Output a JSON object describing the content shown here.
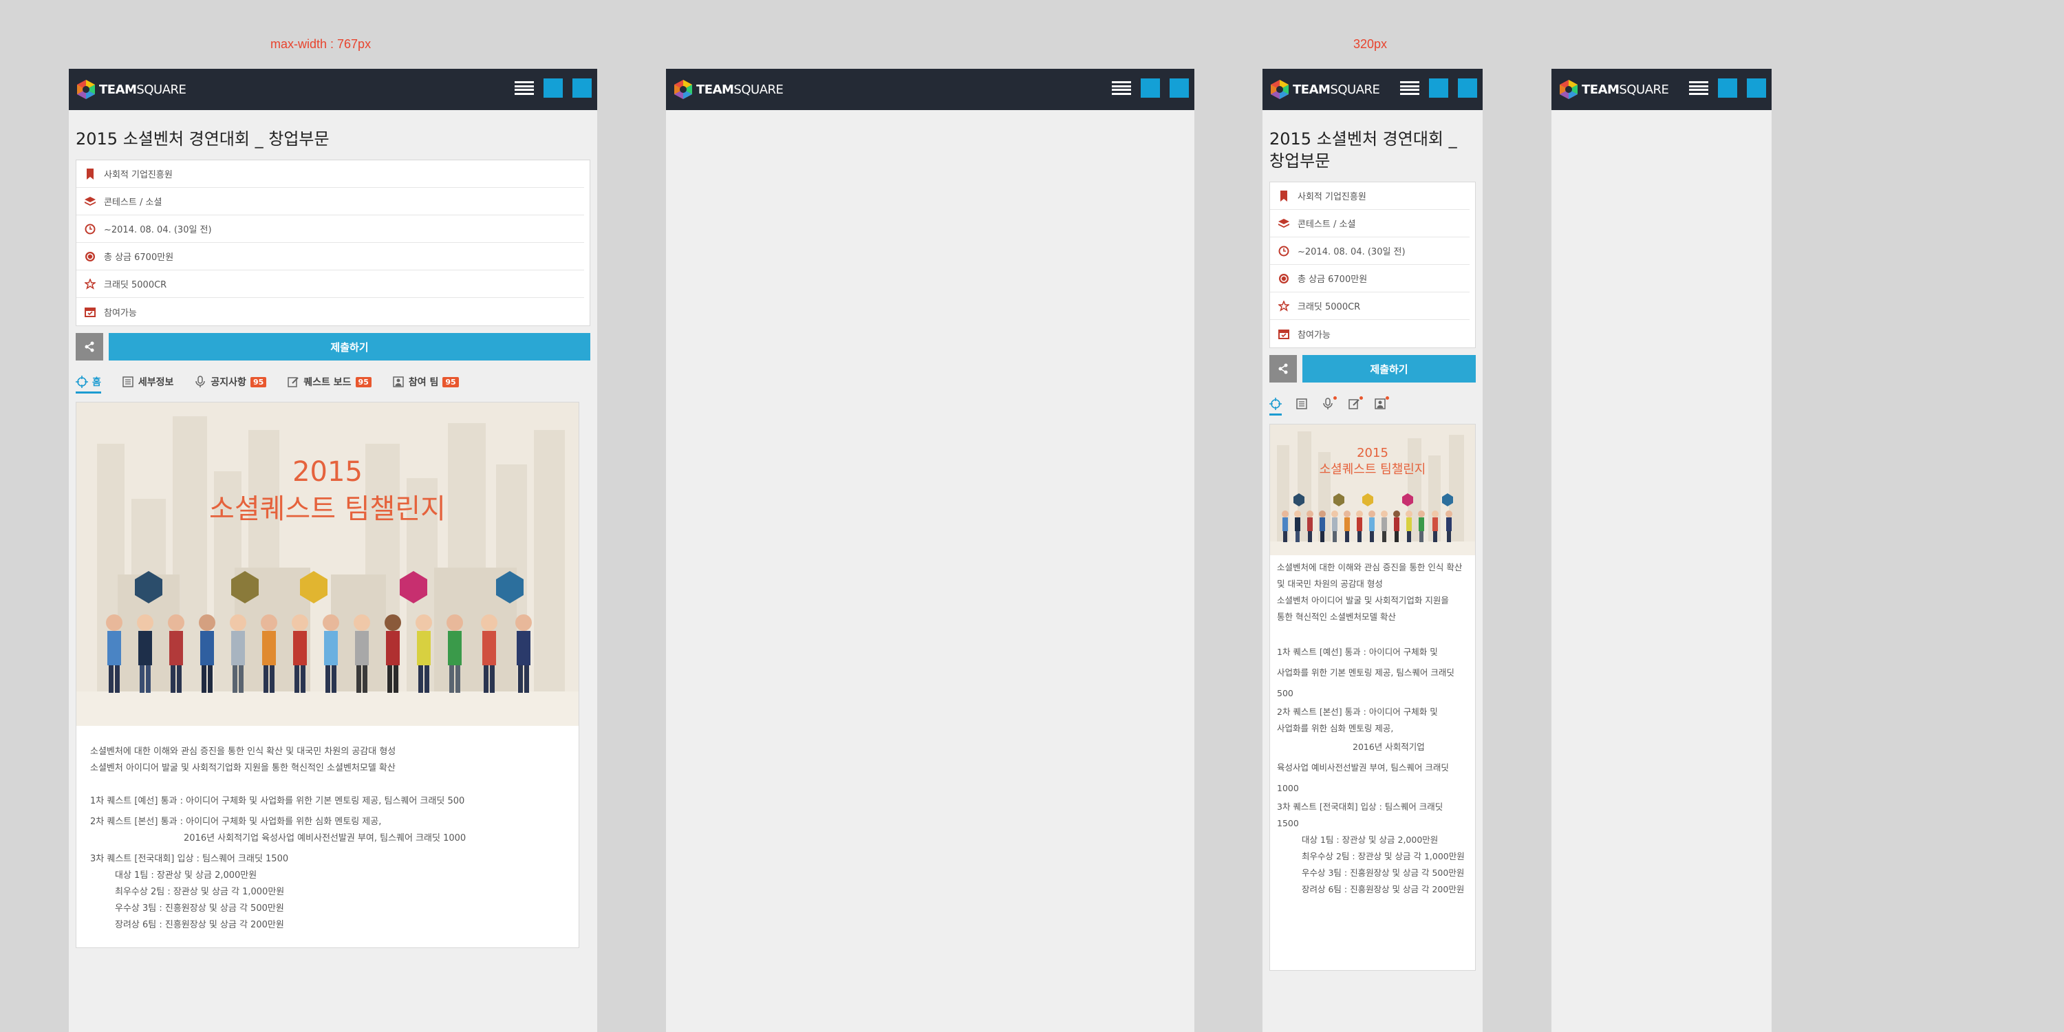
{
  "breakpoints": {
    "large": "max-width : 767px",
    "small": "320px"
  },
  "brand": {
    "bold": "TEAM",
    "light": "SQUARE"
  },
  "accent": "#14a0d6",
  "page": {
    "title_line1": "2015 소셜벤처 경연대회 _",
    "title_line2": "창업부문",
    "title_full": "2015 소셜벤처 경연대회 _ 창업부문"
  },
  "info": [
    {
      "icon": "bookmark-icon",
      "text": "사회적 기업진흥원"
    },
    {
      "icon": "stack-icon",
      "text": "콘테스트 / 소셜"
    },
    {
      "icon": "clock-icon",
      "text": "~2014. 08. 04. (30일 전)"
    },
    {
      "icon": "coin-icon",
      "text": "총 상금 6700만원"
    },
    {
      "icon": "star-icon",
      "text": "크래딧 5000CR"
    },
    {
      "icon": "calendar-icon",
      "text": "참여가능"
    }
  ],
  "actions": {
    "submit": "제출하기"
  },
  "tabs": [
    {
      "label": "홈",
      "icon": "target-icon",
      "badge": null
    },
    {
      "label": "세부정보",
      "icon": "document-icon",
      "badge": null
    },
    {
      "label": "공지사항",
      "icon": "microphone-icon",
      "badge": "95"
    },
    {
      "label": "퀘스트 보드",
      "icon": "edit-icon",
      "badge": "95"
    },
    {
      "label": "참여 팀",
      "icon": "team-icon",
      "badge": "95"
    }
  ],
  "banner": {
    "year": "2015",
    "headline": "소셜퀘스트 팀챌린지"
  },
  "description": {
    "intro1": "소셜벤처에 대한 이해와 관심 증진을 통한 인식 확산 및 대국민 차원의 공감대 형성",
    "intro1_a": "소셜벤처에 대한 이해와 관심 증진을 통한 인식 확산",
    "intro1_b": "및 대국민 차원의 공감대 형성",
    "intro2": "소셜벤처 아이디어 발굴 및 사회적기업화 지원을 통한 혁신적인 소셜벤처모델 확산",
    "intro2_a": "소셜벤처 아이디어 발굴 및 사회적기업화 지원을",
    "intro2_b": "통한 혁신적인 소셜벤처모델 확산",
    "q1": "1차 퀘스트 [예선] 통과 : 아이디어 구체화 및 사업화를 위한 기본 멘토링 제공, 팀스퀘어 크래딧 500",
    "q1_a": "1차 퀘스트 [예선] 통과 : 아이디어 구체화 및",
    "q1_b": "사업화를 위한 기본 멘토링 제공, 팀스퀘어 크래딧",
    "q1_c": "500",
    "q2": "2차 퀘스트 [본선] 통과 : 아이디어 구체화 및 사업화를 위한 심화 멘토링 제공,",
    "q2_a": "2차 퀘스트 [본선] 통과 : 아이디어 구체화 및",
    "q2_b": "사업화를 위한 심화 멘토링 제공,",
    "q2_sub": "2016년 사회적기업 육성사업 예비사전선발권 부여, 팀스퀘어 크래딧 1000",
    "q2_sub_a": "2016년 사회적기업",
    "q2_sub_b": "육성사업 예비사전선발권 부여, 팀스퀘어 크래딧",
    "q2_sub_c": "1000",
    "q3": "3차 퀘스트 [전국대회] 입상 : 팀스퀘어 크래딧 1500",
    "q3_a": "3차 퀘스트 [전국대회] 입상 : 팀스퀘어 크래딧",
    "q3_b": "1500",
    "prizes": [
      "대상 1팀 : 장관상 및 상금 2,000만원",
      "최우수상 2팀 : 장관상 및 상금 각 1,000만원",
      "우수상 3팀 : 진흥원장상 및 상금 각 500만원",
      "장려상 6팀 : 진흥원장상 및 상금 각 200만원"
    ]
  }
}
